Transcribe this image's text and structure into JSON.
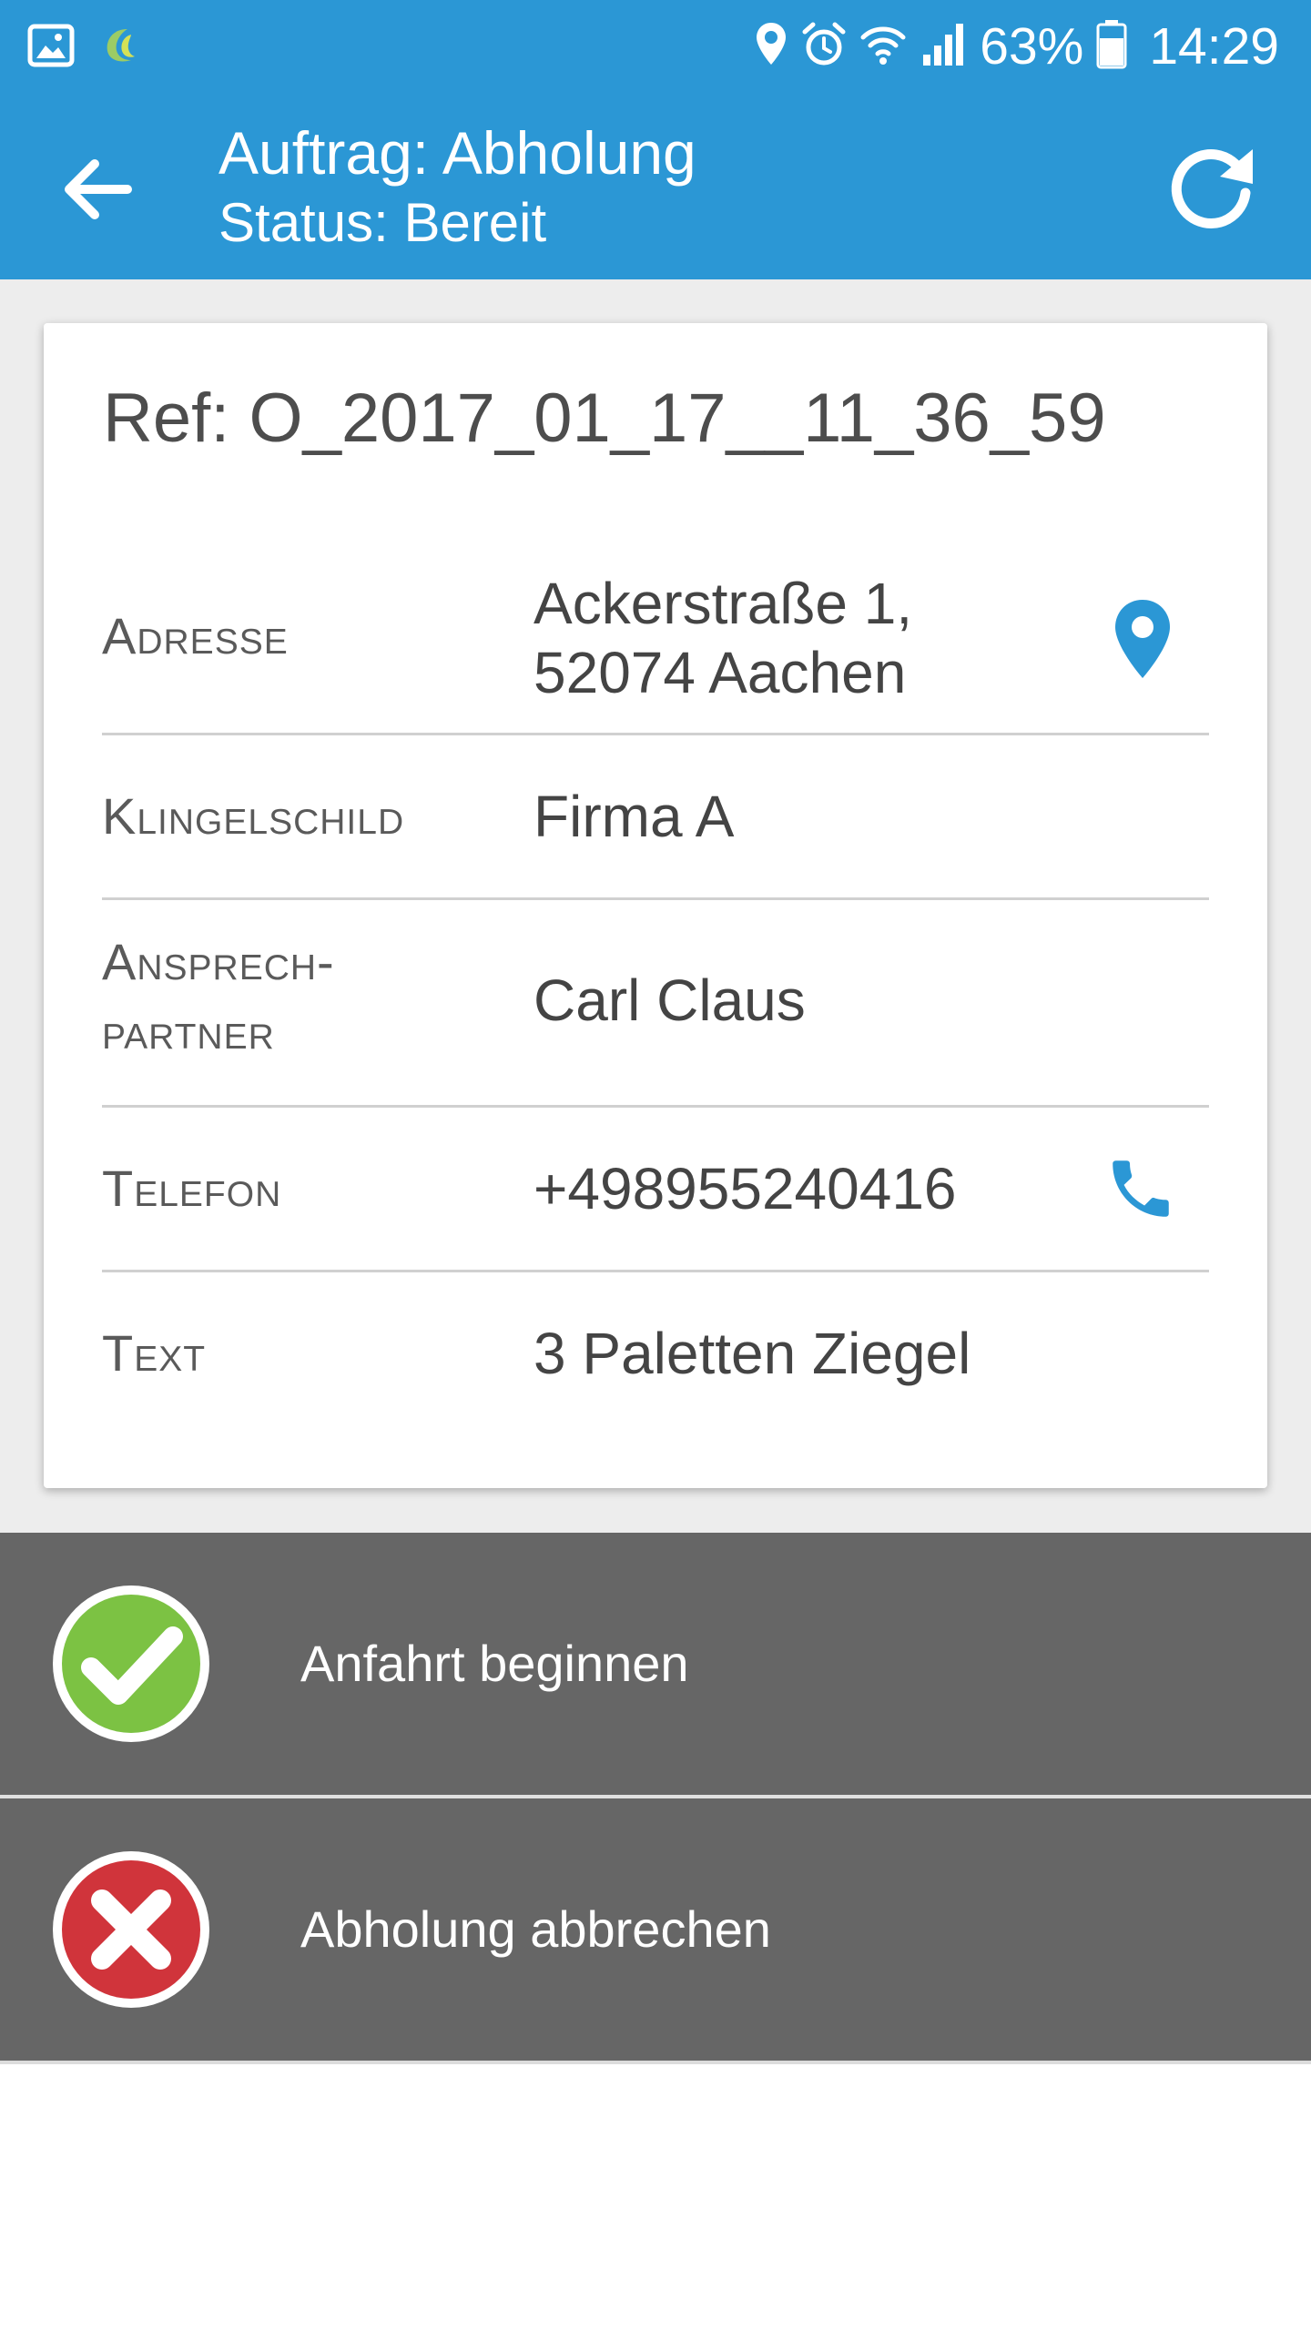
{
  "status_bar": {
    "battery_percent": "63%",
    "time": "14:29",
    "icons": [
      "gallery-icon",
      "app-notification-icon",
      "location-icon",
      "alarm-icon",
      "wifi-icon",
      "signal-icon",
      "battery-icon"
    ]
  },
  "header": {
    "title": "Auftrag: Abholung",
    "subtitle": "Status: Bereit",
    "back_icon": "arrow-left-icon",
    "refresh_icon": "refresh-icon"
  },
  "order": {
    "ref": "Ref: O_2017_01_17__11_36_59",
    "rows": [
      {
        "label": "Adresse",
        "value_line1": "Ackerstraße 1,",
        "value_line2": "52074 Aachen",
        "icon": "map-pin-icon"
      },
      {
        "label": "Klingelschild",
        "value": "Firma A"
      },
      {
        "label_line1": "Ansprech-",
        "label_line2": "partner",
        "value": "Carl Claus"
      },
      {
        "label": "Telefon",
        "value": "+498955240416",
        "icon": "phone-icon"
      },
      {
        "label": "Text",
        "value": "3 Paletten Ziegel"
      }
    ]
  },
  "actions": [
    {
      "label": "Anfahrt beginnen",
      "icon": "check-circle-icon"
    },
    {
      "label": "Abholung abbrechen",
      "icon": "cancel-circle-icon"
    }
  ],
  "colors": {
    "primary": "#2b97d5",
    "action_bg": "#666666",
    "confirm": "#7cc243",
    "cancel": "#d0343b"
  }
}
